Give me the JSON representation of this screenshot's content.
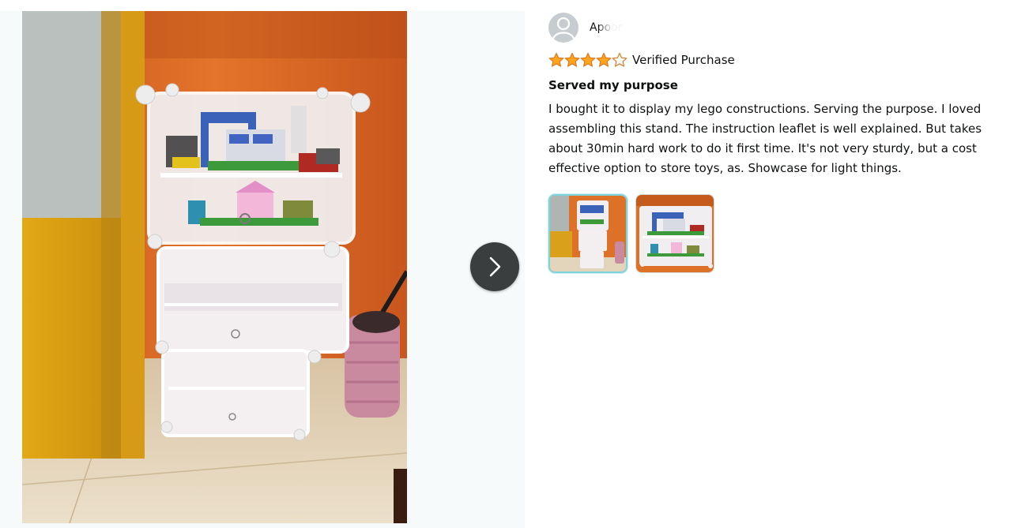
{
  "viewer": {
    "photo_alt": "Customer photo: white plastic storage shelf displaying lego constructions",
    "next_button_icon": "chevron-right-icon"
  },
  "review": {
    "reviewer_name": "Apoor",
    "avatar_icon": "user-avatar-icon",
    "rating": 4,
    "rating_max": 5,
    "verified_label": "Verified Purchase",
    "title": "Served my purpose",
    "body": "I bought it to display my lego constructions. Serving the purpose. I loved assembling this stand. The instruction leaflet is well explained. But takes about 30min hard work to do it first time. It's not very sturdy, but a cost effective option to store toys, as. Showcase for light things.",
    "thumbnails": [
      {
        "alt": "Full shelf photo",
        "selected": true
      },
      {
        "alt": "Top shelf close-up",
        "selected": false
      }
    ]
  },
  "colors": {
    "star_filled": "#ffa41c",
    "star_outline": "#de7921",
    "next_button_bg": "#3b3e3f",
    "selected_thumb_border": "#7fd3dd",
    "viewer_bg": "#f7fafa"
  }
}
